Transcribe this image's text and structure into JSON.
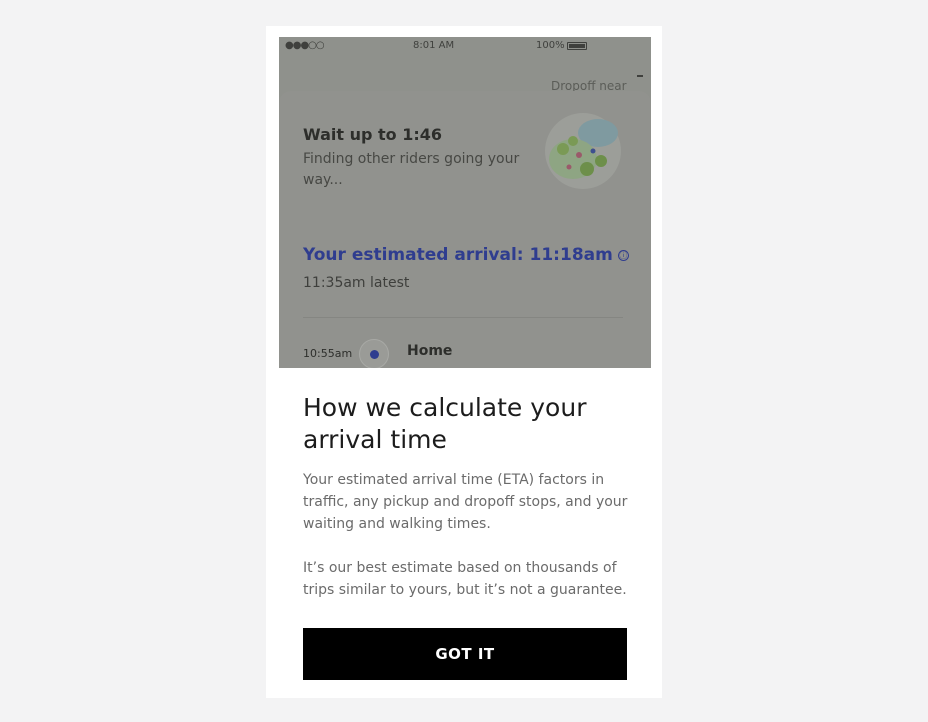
{
  "status_bar": {
    "carrier": "●●●○○",
    "time": "8:01 AM",
    "battery": "100%"
  },
  "map": {
    "dropoff_label": "Dropoff near"
  },
  "trip_card": {
    "wait_title": "Wait up to 1:46",
    "wait_subtitle": "Finding other riders going your way...",
    "eta_title": "Your estimated arrival: 11:18am",
    "info_icon": "ⓘ",
    "eta_latest": "11:35am latest",
    "stop_time": "10:55am",
    "stop_name": "Home"
  },
  "modal": {
    "title": "How we calculate your arrival time",
    "paragraph_1": "Your estimated arrival time (ETA) factors in traffic, any pickup and dropoff stops, and your waiting and walking times.",
    "paragraph_2": "It’s our best estimate based on thousands of trips similar to yours, but it’s not a guarantee.",
    "button_label": "GOT IT"
  },
  "colors": {
    "accent_blue": "#2f3d8f",
    "button_bg": "#000000",
    "overlay": "#8f918c"
  }
}
